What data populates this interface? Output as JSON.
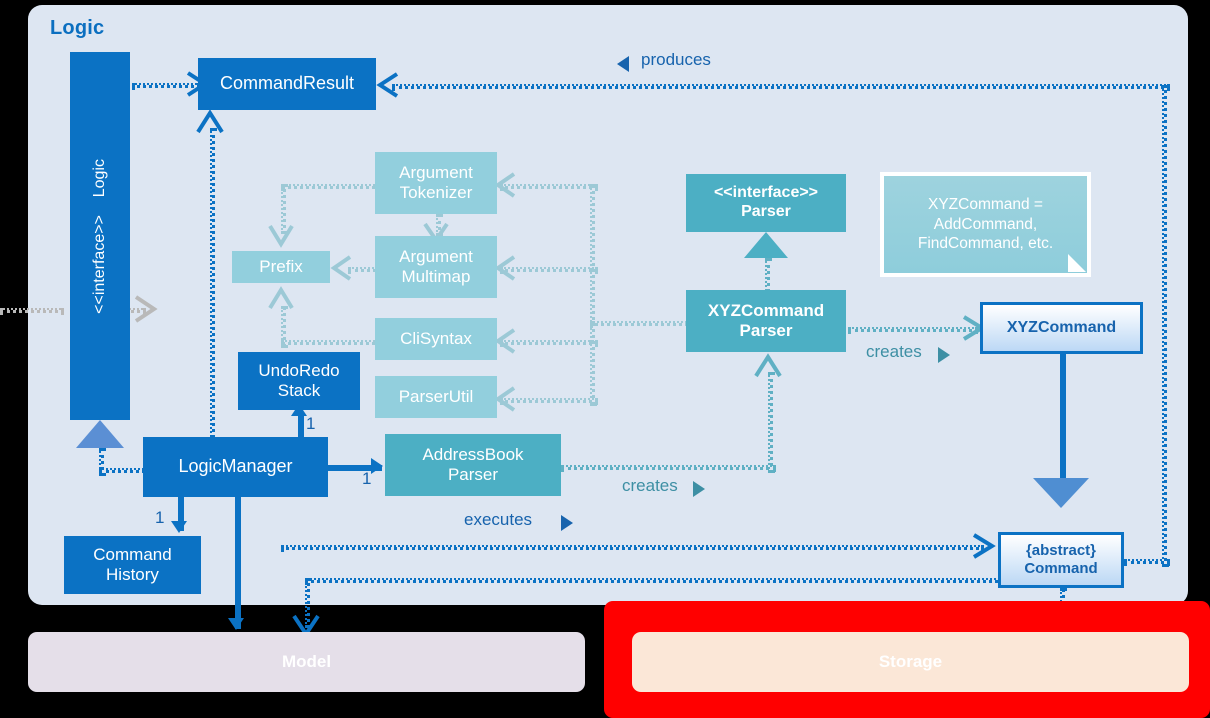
{
  "diagram": {
    "title": "Logic",
    "panels": [
      {
        "id": "logic",
        "label": "Logic"
      },
      {
        "id": "model",
        "label": "Model"
      },
      {
        "id": "storage",
        "label": "Storage"
      }
    ],
    "colors": {
      "panel_bg": "#dde6f2",
      "dark_blue": "#0b72c4",
      "teal": "#4cafc4",
      "light_teal": "#92cfdd",
      "model_panel": "#e5dfe9",
      "storage_panel": "#fbe7d7",
      "highlight_red": "#ff0000",
      "text_blue": "#1763ad"
    },
    "classes": {
      "logic_interface": {
        "stereotype": "<<interface>>",
        "name": "Logic"
      },
      "command_result": {
        "name": "CommandResult"
      },
      "argument_tokenizer": {
        "line1": "Argument",
        "line2": "Tokenizer"
      },
      "argument_multimap": {
        "line1": "Argument",
        "line2": "Multimap"
      },
      "cli_syntax": {
        "name": "CliSyntax"
      },
      "parser_util": {
        "name": "ParserUtil"
      },
      "prefix": {
        "name": "Prefix"
      },
      "undo_redo_stack": {
        "line1": "UndoRedo",
        "line2": "Stack"
      },
      "logic_manager": {
        "name": "LogicManager"
      },
      "command_history": {
        "line1": "Command",
        "line2": "History"
      },
      "address_book_parser": {
        "line1": "AddressBook",
        "line2": "Parser"
      },
      "parser_interface": {
        "stereotype": "<<interface>>",
        "name": "Parser"
      },
      "xyz_command_parser": {
        "line1": "XYZCommand",
        "line2": "Parser"
      },
      "xyz_command": {
        "name": "XYZCommand"
      },
      "abstract_command": {
        "line1": "{abstract}",
        "line2": "Command"
      }
    },
    "note": {
      "line1": "XYZCommand =",
      "line2": "AddCommand,",
      "line3": "FindCommand, etc."
    },
    "edge_labels": {
      "produces": "produces",
      "creates_parser": "creates",
      "creates_abparser": "creates",
      "executes": "executes"
    },
    "multiplicities": {
      "undoredo": "1",
      "abparser": "1",
      "cmdhistory": "1"
    }
  }
}
